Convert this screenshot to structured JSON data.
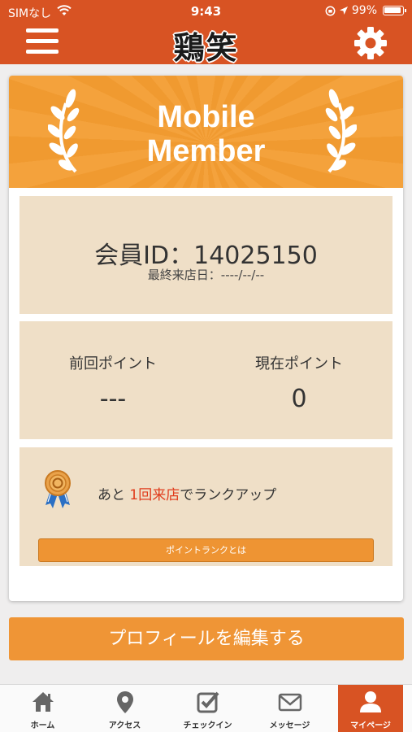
{
  "status_bar": {
    "carrier": "SIMなし",
    "time": "9:43",
    "battery": "99%"
  },
  "header": {
    "logo_text": "鶏笑",
    "menu_icon": "hamburger-menu-icon",
    "settings_icon": "gear-icon"
  },
  "member_card": {
    "banner_title_line1": "Mobile",
    "banner_title_line2": "Member",
    "member_id": "会員ID：14025150",
    "last_visit": "最終来店日：----/--/--",
    "previous_points_label": "前回ポイント",
    "previous_points_value": "---",
    "current_points_label": "現在ポイント",
    "current_points_value": "0",
    "rank_prefix": "あと",
    "rank_highlight": "1回来店",
    "rank_suffix": "でランクアップ",
    "rank_info_button": "ポイントランクとは"
  },
  "profile_button": "プロフィールを編集する",
  "tabbar": {
    "tabs": [
      {
        "label": "ホーム",
        "icon": "home-icon"
      },
      {
        "label": "アクセス",
        "icon": "map-pin-icon"
      },
      {
        "label": "チェックイン",
        "icon": "checkbox-icon"
      },
      {
        "label": "メッセージ",
        "icon": "envelope-icon"
      },
      {
        "label": "マイページ",
        "icon": "person-icon"
      }
    ],
    "active_index": 4
  },
  "colors": {
    "header": "#d85323",
    "accent": "#ef9536",
    "panel": "#efdfc7",
    "highlight": "#e03c1c"
  }
}
